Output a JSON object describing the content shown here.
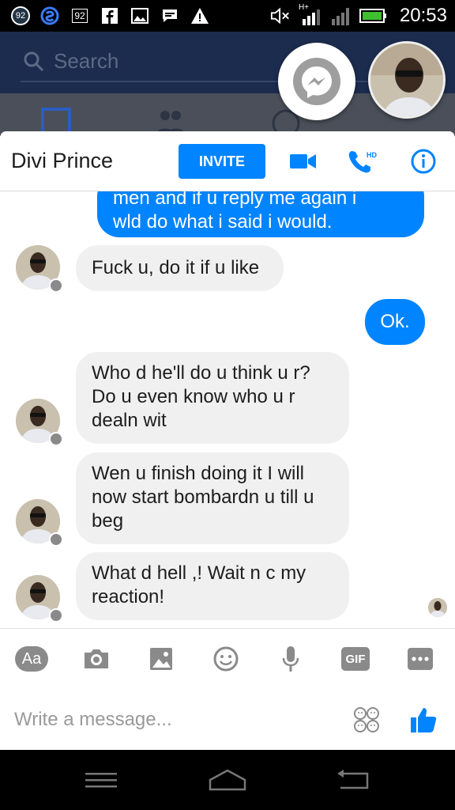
{
  "status_bar": {
    "badge_left": "92",
    "badge_mid": "92",
    "network": "H+",
    "time": "20:53"
  },
  "background_app": {
    "search_placeholder": "Search"
  },
  "chat": {
    "contact_name": "Divi Prince",
    "invite_label": "INVITE",
    "hd_label": "HD",
    "messages": [
      {
        "dir": "out",
        "lines": [
          "men and if u reply me again i",
          "wld do what i said i would."
        ]
      },
      {
        "dir": "in",
        "lines": [
          "Fuck u, do it if u like"
        ]
      },
      {
        "dir": "out",
        "lines": [
          "Ok."
        ]
      },
      {
        "dir": "in",
        "lines": [
          "Who d he'll do u think u r?",
          "Do u even know who u r",
          "dealn wit"
        ]
      },
      {
        "dir": "in",
        "lines": [
          "Wen u finish doing it I will",
          "now start bombardn u till u",
          "beg"
        ]
      },
      {
        "dir": "in",
        "lines": [
          "What d hell ,! Wait n c my",
          "reaction!"
        ]
      }
    ]
  },
  "toolbar": {
    "text_label": "Aa",
    "gif_label": "GIF"
  },
  "composer": {
    "placeholder": "Write a message..."
  },
  "colors": {
    "accent": "#0084ff",
    "incoming_bubble": "#f0f0f0",
    "icon_grey": "#8a8a8a"
  }
}
